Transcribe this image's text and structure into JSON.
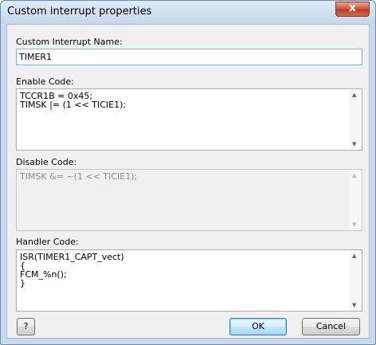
{
  "window": {
    "title": "Custom interrupt properties",
    "close_symbol": "x"
  },
  "name": {
    "label": "Custom Interrupt Name:",
    "value": "TIMER1"
  },
  "enable": {
    "label": "Enable Code:",
    "code": "TCCR1B = 0x45;\nTIMSK |= (1 << TICIE1);"
  },
  "disable": {
    "label": "Disable Code:",
    "code": "TIMSK &= ~(1 << TICIE1);"
  },
  "handler": {
    "label": "Handler Code:",
    "code": "ISR(TIMER1_CAPT_vect)\n{\nFCM_%n();\n}"
  },
  "scroll": {
    "up": "▲",
    "down": "▼"
  },
  "buttons": {
    "help": "?",
    "ok": "OK",
    "cancel": "Cancel"
  }
}
